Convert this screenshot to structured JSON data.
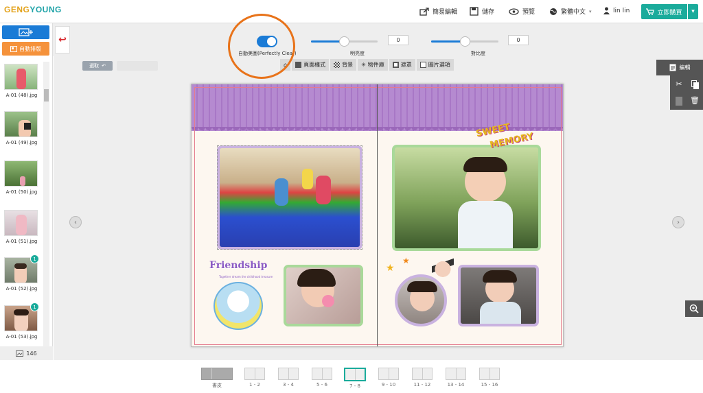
{
  "header": {
    "logo_part1": "GENG",
    "logo_part2": "YOUNG",
    "nav": {
      "easy_edit": "簡易編輯",
      "save": "儲存",
      "preview": "預覽",
      "language": "繁體中文",
      "user": "lin lin"
    },
    "buy_label": "立即購買"
  },
  "toolbar": {
    "auto_enhance_label": "自動美圖(Perfectly Clear)",
    "brightness_label": "明亮度",
    "brightness_value": "0",
    "contrast_label": "對比度",
    "contrast_value": "0"
  },
  "edit_bar": {
    "select_label": "選取",
    "tools": [
      {
        "label": "頁面樣式",
        "icon": "layout-icon"
      },
      {
        "label": "背景",
        "icon": "checker-icon"
      },
      {
        "label": "物件庫",
        "icon": "sparkle-icon"
      },
      {
        "label": "遮罩",
        "icon": "mask-icon"
      },
      {
        "label": "圖片選項",
        "icon": "image-icon"
      }
    ]
  },
  "sidebar": {
    "thumbnails": [
      {
        "caption": "A-01 (48).jpg",
        "badge": ""
      },
      {
        "caption": "A-01 (49).jpg",
        "badge": ""
      },
      {
        "caption": "A-01 (50).jpg",
        "badge": ""
      },
      {
        "caption": "A-01 (51).jpg",
        "badge": ""
      },
      {
        "caption": "A-01 (52).jpg",
        "badge": "1"
      },
      {
        "caption": "A-01 (53).jpg",
        "badge": "1"
      }
    ],
    "photo_count": "146"
  },
  "right_panel": {
    "edit_label": "編輯"
  },
  "spread": {
    "sticker_text_1": "SWEET",
    "sticker_text_2": "MEMORY",
    "friendship_text": "Friendship",
    "friendship_sub": "Together dream the childhood treasure"
  },
  "pages": [
    {
      "label": "書皮",
      "active": false
    },
    {
      "label": "1 - 2",
      "active": false
    },
    {
      "label": "3 - 4",
      "active": false
    },
    {
      "label": "5 - 6",
      "active": false
    },
    {
      "label": "7 - 8",
      "active": true
    },
    {
      "label": "9 - 10",
      "active": false
    },
    {
      "label": "11 - 12",
      "active": false
    },
    {
      "label": "13 - 14",
      "active": false
    },
    {
      "label": "15 - 16",
      "active": false
    }
  ],
  "colors": {
    "accent_teal": "#1aab9b",
    "primary_blue": "#1a7bd6",
    "orange": "#f5923b",
    "highlight_ring": "#e8731a"
  }
}
